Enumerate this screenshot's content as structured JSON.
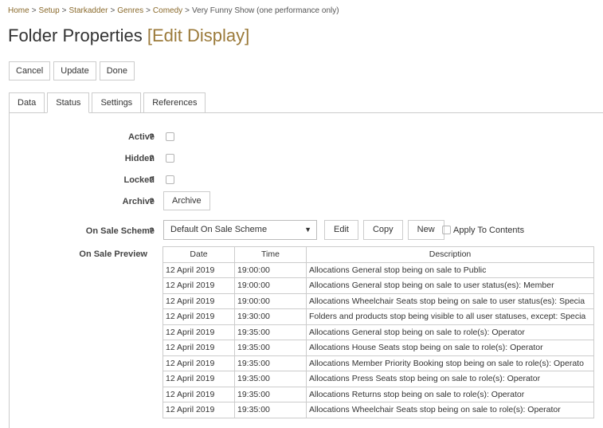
{
  "breadcrumb": {
    "items": [
      "Home",
      "Setup",
      "Starkadder",
      "Genres",
      "Comedy"
    ],
    "current": "Very Funny Show (one performance only)",
    "separator": ">"
  },
  "title": {
    "main": "Folder Properties",
    "mode": "[Edit Display]"
  },
  "toolbar": {
    "cancel": "Cancel",
    "update": "Update",
    "done": "Done"
  },
  "tabs": [
    "Data",
    "Status",
    "Settings",
    "References"
  ],
  "active_tab": "Status",
  "status": {
    "help_mark": "?",
    "active_label": "Active",
    "hidden_label": "Hidden",
    "locked_label": "Locked",
    "archive_label": "Archive",
    "archive_button": "Archive",
    "on_sale_scheme_label": "On Sale Scheme",
    "on_sale_scheme_value": "Default On Sale Scheme",
    "edit_button": "Edit",
    "copy_button": "Copy",
    "new_button": "New",
    "apply_to_contents": "Apply To Contents",
    "active_checked": false,
    "hidden_checked": false,
    "locked_checked": false,
    "apply_checked": false
  },
  "preview": {
    "label": "On Sale Preview",
    "columns": [
      "Date",
      "Time",
      "Description"
    ],
    "rows": [
      [
        "12 April 2019",
        "19:00:00",
        "Allocations General stop being on sale to Public"
      ],
      [
        "12 April 2019",
        "19:00:00",
        "Allocations General stop being on sale to user status(es):  Member"
      ],
      [
        "12 April 2019",
        "19:00:00",
        "Allocations Wheelchair Seats stop being on sale to user status(es):  Specia"
      ],
      [
        "12 April 2019",
        "19:30:00",
        "Folders and products stop being visible to all user statuses, except:  Specia"
      ],
      [
        "12 April 2019",
        "19:35:00",
        "Allocations General stop being on sale to role(s):  Operator"
      ],
      [
        "12 April 2019",
        "19:35:00",
        "Allocations House Seats stop being on sale to role(s):  Operator"
      ],
      [
        "12 April 2019",
        "19:35:00",
        "Allocations Member Priority Booking stop being on sale to role(s):  Operato"
      ],
      [
        "12 April 2019",
        "19:35:00",
        "Allocations Press Seats stop being on sale to role(s):  Operator"
      ],
      [
        "12 April 2019",
        "19:35:00",
        "Allocations Returns stop being on sale to role(s):  Operator"
      ],
      [
        "12 April 2019",
        "19:35:00",
        "Allocations Wheelchair Seats stop being on sale to role(s):  Operator"
      ]
    ]
  },
  "colors": {
    "accent": "#9b7a3a",
    "link": "#8a6a2c",
    "border": "#cccccc"
  }
}
